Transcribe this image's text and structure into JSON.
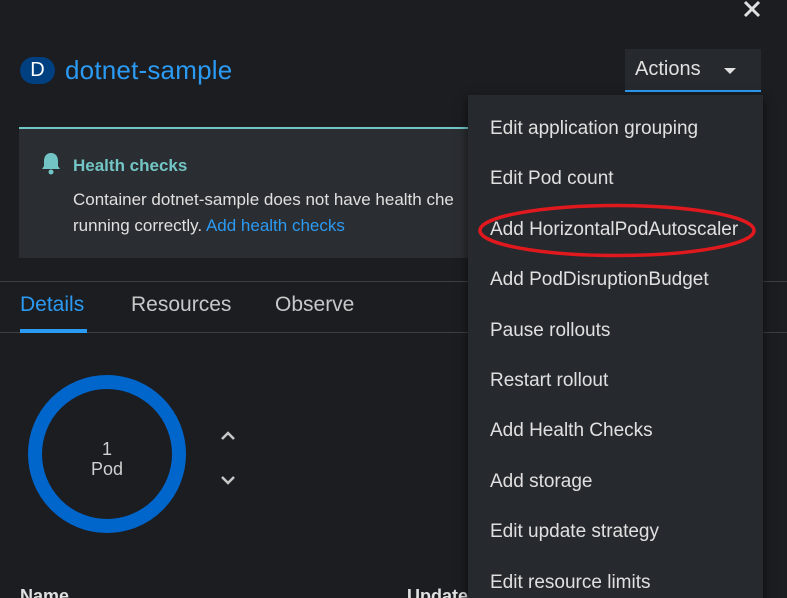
{
  "header": {
    "avatar_letter": "D",
    "title": "dotnet-sample"
  },
  "actions": {
    "label": "Actions",
    "menu_items": [
      "Edit application grouping",
      "Edit Pod count",
      "Add HorizontalPodAutoscaler",
      "Add PodDisruptionBudget",
      "Pause rollouts",
      "Restart rollout",
      "Add Health Checks",
      "Add storage",
      "Edit update strategy",
      "Edit resource limits"
    ],
    "highlighted_item": "Add HorizontalPodAutoscaler"
  },
  "alert": {
    "title": "Health checks",
    "body": "Container dotnet-sample does not have health che",
    "body_line2": "running correctly.",
    "link": "Add health checks"
  },
  "tabs": [
    {
      "label": "Details",
      "active": true
    },
    {
      "label": "Resources",
      "active": false
    },
    {
      "label": "Observe",
      "active": false
    }
  ],
  "pods": {
    "count": "1",
    "label": "Pod"
  },
  "table": {
    "col_name": "Name",
    "col_updated": "Update"
  },
  "colors": {
    "background": "#1b1d21",
    "accent": "#2b9af3",
    "alert_teal": "#73c5c5",
    "menu_bg": "#26292d",
    "donut": "#0066cc",
    "annotation_red": "#e0191f"
  },
  "icons": {
    "close": "close-icon",
    "bell": "bell-icon",
    "caret": "caret-down-icon",
    "up": "chevron-up-icon",
    "down": "chevron-down-icon"
  }
}
